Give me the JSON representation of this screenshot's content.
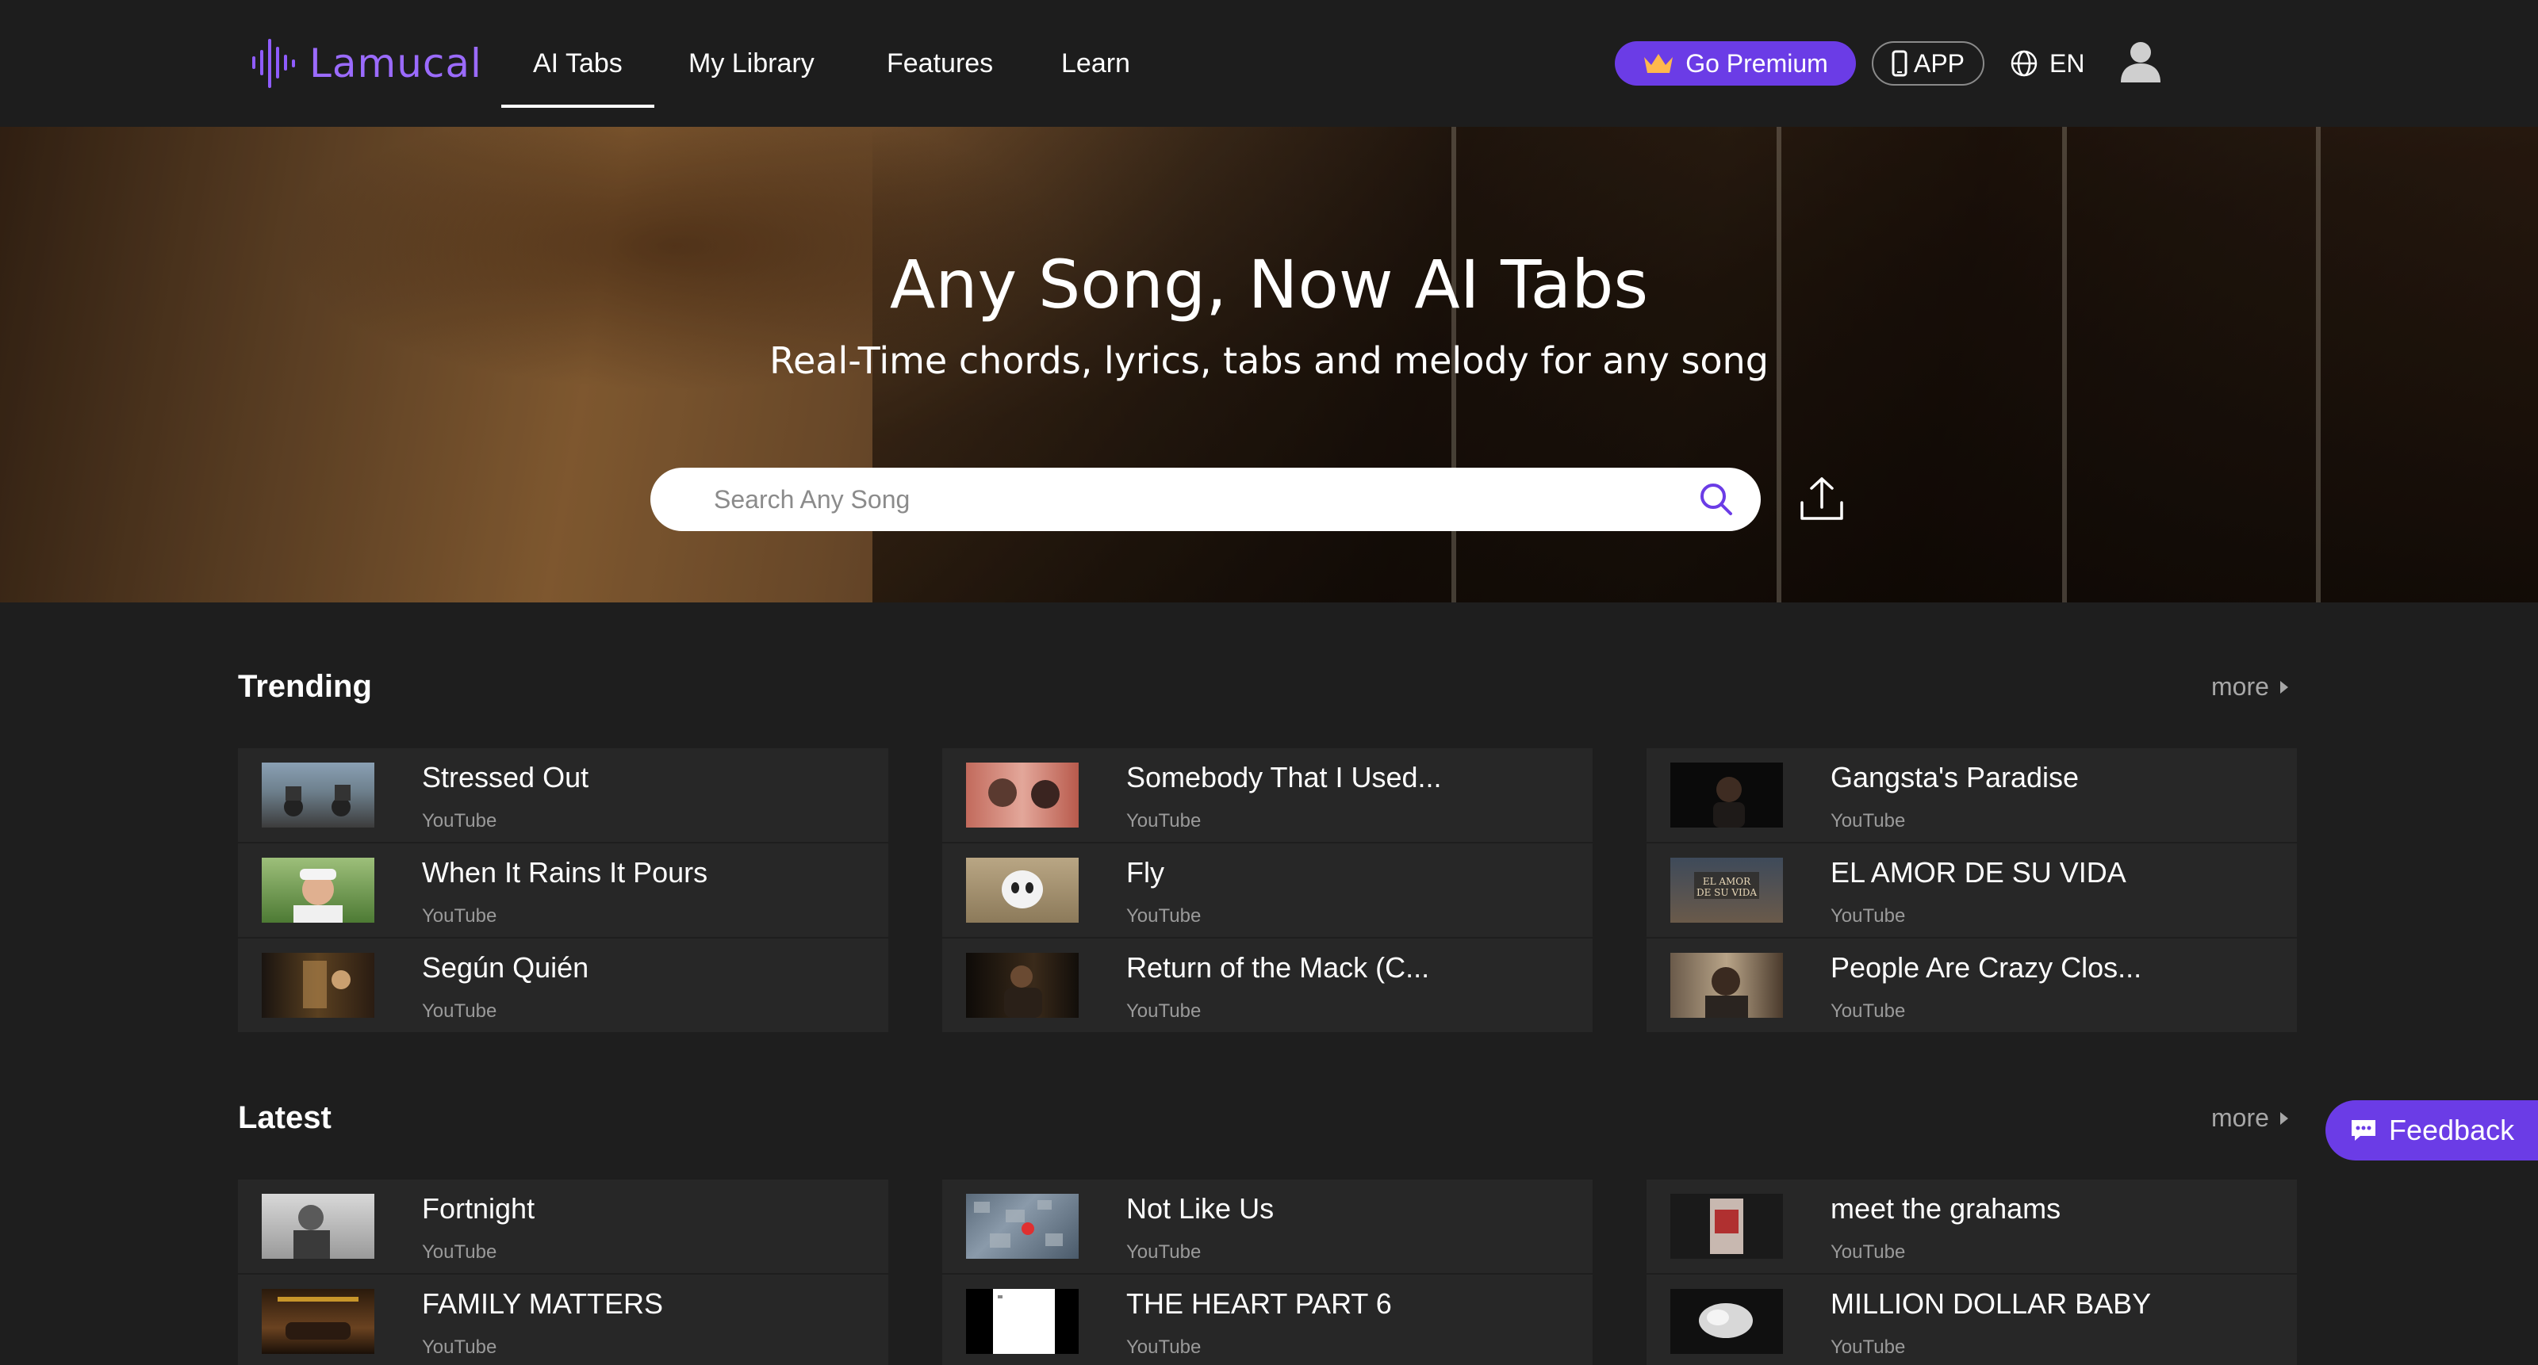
{
  "header": {
    "logo_text": "Lamucal",
    "nav": [
      {
        "label": "AI Tabs",
        "active": true
      },
      {
        "label": "My Library"
      },
      {
        "label": "Features"
      },
      {
        "label": "Learn"
      }
    ],
    "premium_label": "Go Premium",
    "app_label": "APP",
    "lang_label": "EN"
  },
  "hero": {
    "title": "Any Song, Now AI Tabs",
    "subtitle": "Real-Time chords, lyrics, tabs and melody for any song",
    "search_placeholder": "Search Any Song"
  },
  "trending": {
    "title": "Trending",
    "more": "more",
    "columns": [
      [
        {
          "title": "Stressed Out",
          "source": "YouTube"
        },
        {
          "title": "When It Rains It Pours",
          "source": "YouTube"
        },
        {
          "title": "Según Quién",
          "source": "YouTube"
        }
      ],
      [
        {
          "title": "Somebody That I Used...",
          "source": "YouTube"
        },
        {
          "title": "Fly",
          "source": "YouTube"
        },
        {
          "title": "Return of the Mack (C...",
          "source": "YouTube"
        }
      ],
      [
        {
          "title": "Gangsta's Paradise",
          "source": "YouTube"
        },
        {
          "title": "EL AMOR DE SU VIDA",
          "source": "YouTube"
        },
        {
          "title": "People Are Crazy Clos...",
          "source": "YouTube"
        }
      ]
    ]
  },
  "latest": {
    "title": "Latest",
    "more": "more",
    "columns": [
      [
        {
          "title": "Fortnight",
          "source": "YouTube"
        },
        {
          "title": "FAMILY MATTERS",
          "source": "YouTube"
        }
      ],
      [
        {
          "title": "Not Like Us",
          "source": "YouTube"
        },
        {
          "title": "THE HEART PART 6",
          "source": "YouTube"
        }
      ],
      [
        {
          "title": "meet the grahams",
          "source": "YouTube"
        },
        {
          "title": "MILLION DOLLAR BABY",
          "source": "YouTube"
        }
      ]
    ]
  },
  "feedback_label": "Feedback",
  "colors": {
    "accent": "#6b3ce6",
    "logo": "#9b6bff",
    "background": "#1e1e1e",
    "row": "#272727"
  }
}
